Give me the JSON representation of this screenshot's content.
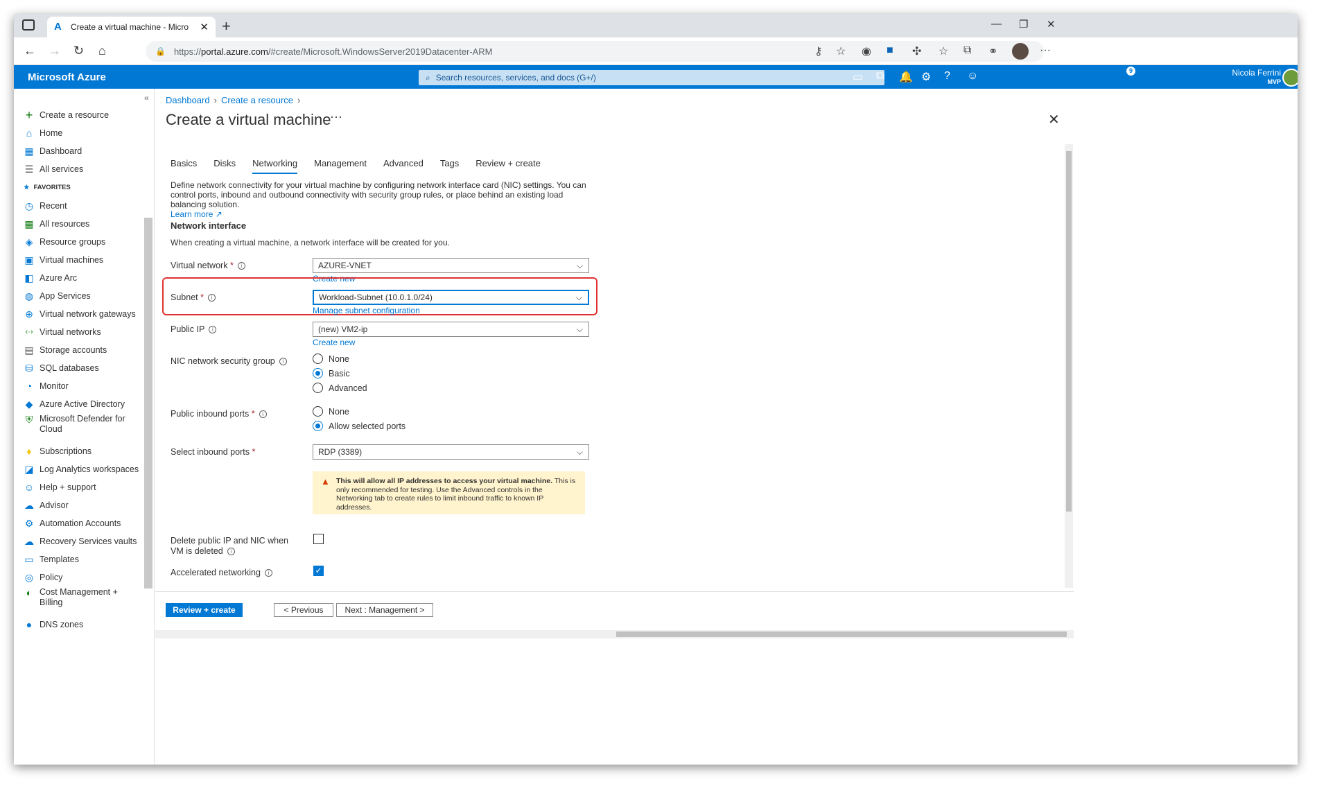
{
  "browser": {
    "tab_title": "Create a virtual machine - Micro",
    "url_prefix": "https://",
    "url_host": "portal.azure.com",
    "url_rest": "/#create/Microsoft.WindowsServer2019Datacenter-ARM"
  },
  "azure": {
    "brand": "Microsoft Azure",
    "search_placeholder": "Search resources, services, and docs (G+/)",
    "notification_count": "9",
    "user_name": "Nicola Ferrini",
    "user_role": "MVP"
  },
  "sidebar": {
    "create": "Create a resource",
    "home": "Home",
    "dashboard": "Dashboard",
    "all_services": "All services",
    "favorites": "FAVORITES",
    "items": [
      "Recent",
      "All resources",
      "Resource groups",
      "Virtual machines",
      "Azure Arc",
      "App Services",
      "Virtual network gateways",
      "Virtual networks",
      "Storage accounts",
      "SQL databases",
      "Monitor",
      "Azure Active Directory",
      "Microsoft Defender for Cloud",
      "Subscriptions",
      "Log Analytics workspaces",
      "Help + support",
      "Advisor",
      "Automation Accounts",
      "Recovery Services vaults",
      "Templates",
      "Policy",
      "Cost Management + Billing",
      "DNS zones"
    ]
  },
  "breadcrumb": [
    "Dashboard",
    "Create a resource"
  ],
  "page_title": "Create a virtual machine",
  "tabs": [
    "Basics",
    "Disks",
    "Networking",
    "Management",
    "Advanced",
    "Tags",
    "Review + create"
  ],
  "description": "Define network connectivity for your virtual machine by configuring network interface card (NIC) settings. You can control ports, inbound and outbound connectivity with security group rules, or place behind an existing load balancing solution.",
  "learn_more": "Learn more",
  "section_title": "Network interface",
  "section_sub": "When creating a virtual machine, a network interface will be created for you.",
  "form": {
    "vnet_label": "Virtual network",
    "vnet_value": "AZURE-VNET",
    "create_new": "Create new",
    "subnet_label": "Subnet",
    "subnet_value": "Workload-Subnet (10.0.1.0/24)",
    "subnet_link": "Manage subnet configuration",
    "pip_label": "Public IP",
    "pip_value": "(new) VM2-ip",
    "nsg_label": "NIC network security group",
    "nsg_options": [
      "None",
      "Basic",
      "Advanced"
    ],
    "ports_label": "Public inbound ports",
    "ports_options": [
      "None",
      "Allow selected ports"
    ],
    "select_ports_label": "Select inbound ports",
    "select_ports_value": "RDP (3389)",
    "warning_bold": "This will allow all IP addresses to access your virtual machine.",
    "warning_text": " This is only recommended for testing.  Use the Advanced controls in the Networking tab to create rules to limit inbound traffic to known IP addresses.",
    "delete_label": "Delete public IP and NIC when VM is deleted",
    "accel_label": "Accelerated networking"
  },
  "footer": {
    "review": "Review + create",
    "previous": "< Previous",
    "next": "Next : Management >"
  }
}
